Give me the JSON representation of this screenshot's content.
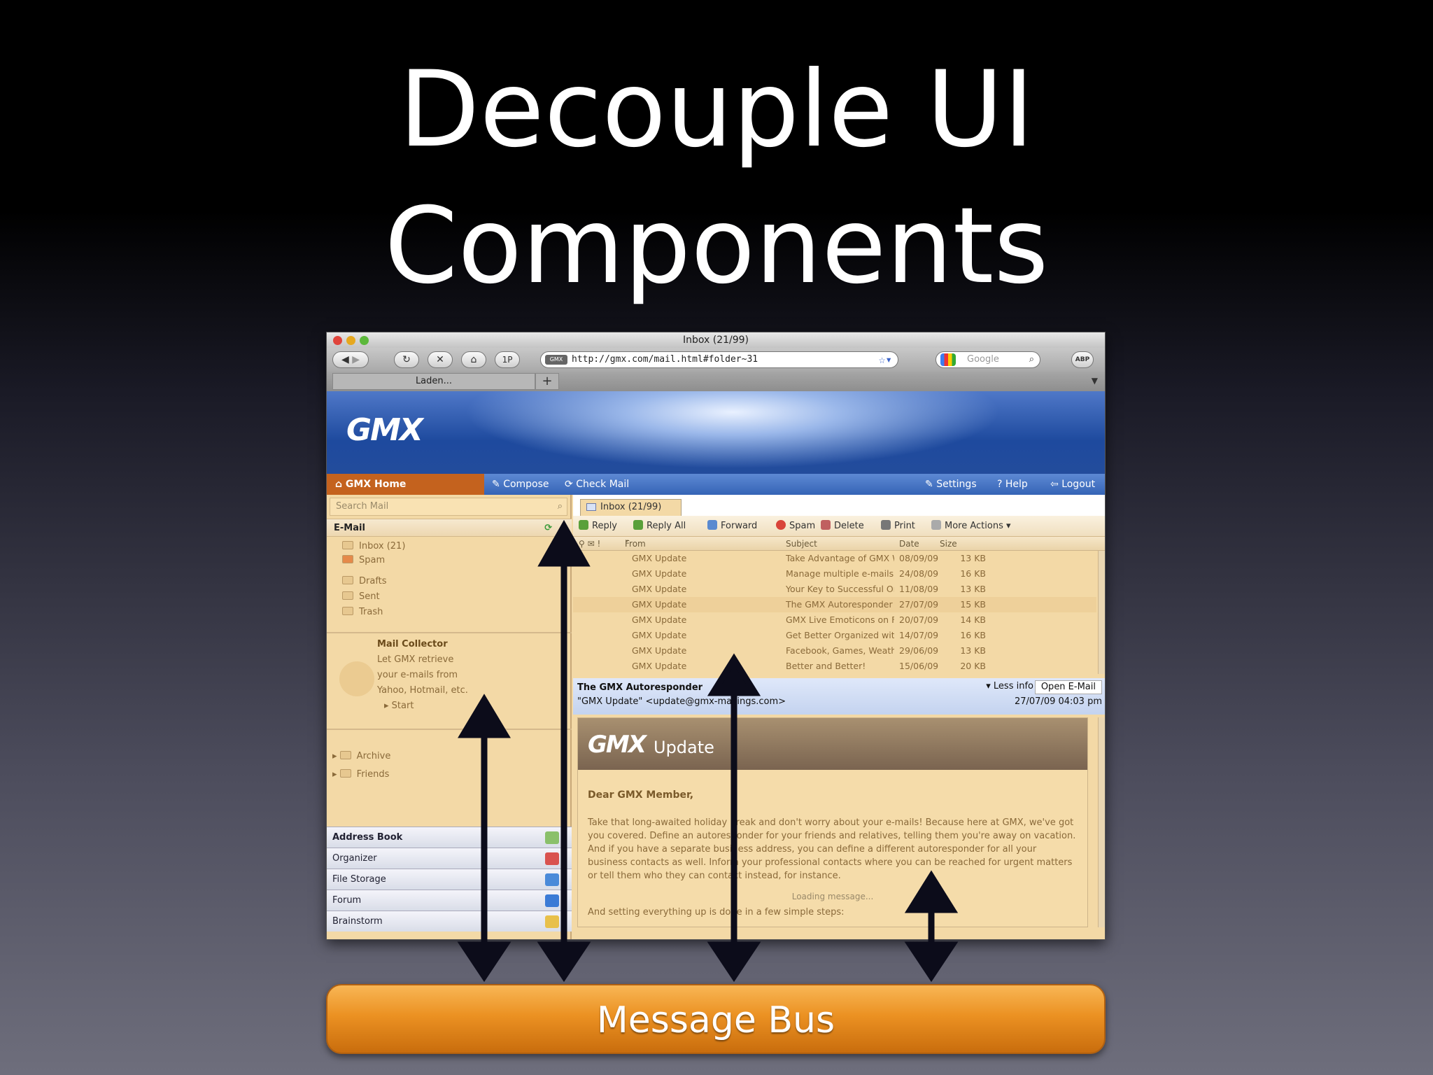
{
  "slide": {
    "title_line1": "Decouple UI",
    "title_line2": "Components",
    "message_bus": "Message Bus"
  },
  "browser": {
    "window_title": "Inbox (21/99)",
    "url": "http://gmx.com/mail.html#folder~31",
    "search_placeholder": "Google",
    "tab_label": "Laden...",
    "tab_add": "+",
    "back": "◀",
    "forward": "▶",
    "reload": "↻",
    "stop": "✕",
    "home": "⌂",
    "onepassword": "1P",
    "adblock": "ABP"
  },
  "gmx": {
    "logo": "GMX",
    "nav": {
      "home": "GMX Home",
      "compose": "Compose",
      "check_mail": "Check Mail",
      "settings": "Settings",
      "help": "Help",
      "logout": "Logout"
    },
    "sidebar": {
      "search_placeholder": "Search Mail",
      "email_header": "E-Mail",
      "folders": [
        "Inbox (21)",
        "Spam",
        "Drafts",
        "Sent",
        "Trash"
      ],
      "collector": {
        "title": "Mail Collector",
        "lines": [
          "Let GMX retrieve",
          "your e-mails from",
          "Yahoo, Hotmail, etc."
        ],
        "start": "Start"
      },
      "extra_folders": [
        "Archive",
        "Friends"
      ],
      "bottom_nav": [
        "Address Book",
        "Organizer",
        "File Storage",
        "Forum",
        "Brainstorm"
      ]
    },
    "main": {
      "tab": "Inbox (21/99)",
      "actions": [
        "Reply",
        "Reply All",
        "Forward",
        "Spam",
        "Delete",
        "Print",
        "More Actions"
      ],
      "columns": [
        "From",
        "Subject",
        "Date",
        "Size"
      ],
      "rows": [
        {
          "from": "GMX Update",
          "subject": "Take Advantage of GMX Withou",
          "date": "08/09/09",
          "size": "13 KB"
        },
        {
          "from": "GMX Update",
          "subject": "Manage multiple e-mails at on",
          "date": "24/08/09",
          "size": "16 KB"
        },
        {
          "from": "GMX Update",
          "subject": "Your Key to Successful Organiz",
          "date": "11/08/09",
          "size": "13 KB"
        },
        {
          "from": "GMX Update",
          "subject": "The GMX Autoresponder",
          "date": "27/07/09",
          "size": "15 KB"
        },
        {
          "from": "GMX Update",
          "subject": "GMX Live Emoticons on Facebo",
          "date": "20/07/09",
          "size": "14 KB"
        },
        {
          "from": "GMX Update",
          "subject": "Get Better Organized with GMX",
          "date": "14/07/09",
          "size": "16 KB"
        },
        {
          "from": "GMX Update",
          "subject": "Facebook, Games, Weather ...",
          "date": "29/06/09",
          "size": "13 KB"
        },
        {
          "from": "GMX Update",
          "subject": "Better and Better!",
          "date": "15/06/09",
          "size": "20 KB"
        }
      ],
      "message": {
        "subject": "The GMX Autoresponder",
        "from": "\"GMX Update\" <update@gmx-mailings.com>",
        "less_info": "Less info",
        "open": "Open E-Mail",
        "date": "27/07/09 04:03 pm",
        "banner_logo": "GMX",
        "banner_sub": "Update",
        "greeting": "Dear GMX Member,",
        "body": "Take that long-awaited holiday break and don't worry about your e-mails! Because here at GMX, we've got you covered. Define an autoresponder for your friends and relatives, telling them you're away on vacation. And if you have a separate business address, you can define a different autoresponder for all your business contacts as well. Inform your professional contacts where you can be reached for urgent matters or tell them who they can contact instead, for instance.",
        "loading": "Loading message...",
        "setup": "And setting everything up is done in a few simple steps:"
      }
    }
  }
}
